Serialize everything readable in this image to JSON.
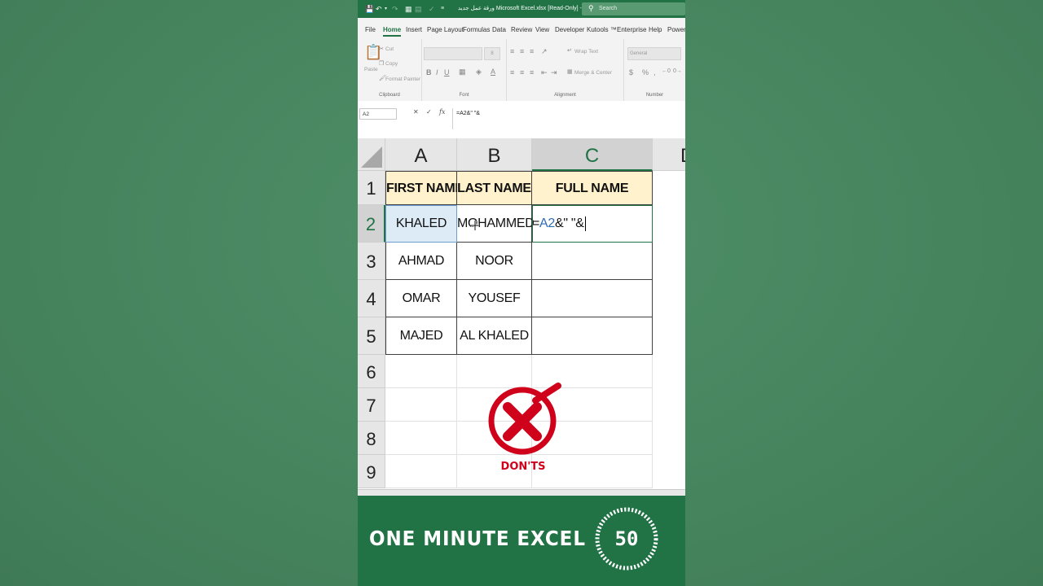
{
  "window": {
    "title": "ورقة عمل جديد Microsoft Excel.xlsx  [Read-Only]  -  Excel",
    "search_placeholder": "Search"
  },
  "ribbon_tabs": [
    "File",
    "Home",
    "Insert",
    "Page Layout",
    "Formulas",
    "Data",
    "Review",
    "View",
    "Developer",
    "Kutools ™",
    "Enterprise",
    "Help",
    "PowerU"
  ],
  "ribbon": {
    "clipboard": {
      "paste": "Paste",
      "cut": "Cut",
      "copy": "Copy",
      "format_painter": "Format Painter",
      "group": "Clipboard"
    },
    "font": {
      "size": "8",
      "group": "Font"
    },
    "alignment": {
      "wrap_text": "Wrap Text",
      "merge_center": "Merge & Center",
      "group": "Alignment"
    },
    "number": {
      "format": "General",
      "group": "Number"
    }
  },
  "formula_bar": {
    "name_box": "A2",
    "formula": "=A2&\" \"&"
  },
  "grid": {
    "columns": [
      "A",
      "B",
      "C",
      "D"
    ],
    "rows": [
      "1",
      "2",
      "3",
      "4",
      "5",
      "6",
      "7",
      "8",
      "9"
    ],
    "headers": [
      "FIRST NAME",
      "LAST NAME",
      "FULL NAME"
    ],
    "data": [
      [
        "KHALED",
        "MOHAMMED"
      ],
      [
        "AHMAD",
        "NOOR"
      ],
      [
        "OMAR",
        "YOUSEF"
      ],
      [
        "MAJED",
        "AL KHALED"
      ]
    ],
    "editing": {
      "prefix": "=",
      "ref": "A2",
      "suffix": "&\" \"&"
    }
  },
  "badge": {
    "label": "DON'TS"
  },
  "footer": {
    "brand": "ONE MINUTE EXCEL",
    "timer": "50"
  },
  "colors": {
    "excel_green": "#217346",
    "header_fill": "#fff2cc",
    "badge_red": "#d0021b",
    "background": "#4a8a63"
  }
}
